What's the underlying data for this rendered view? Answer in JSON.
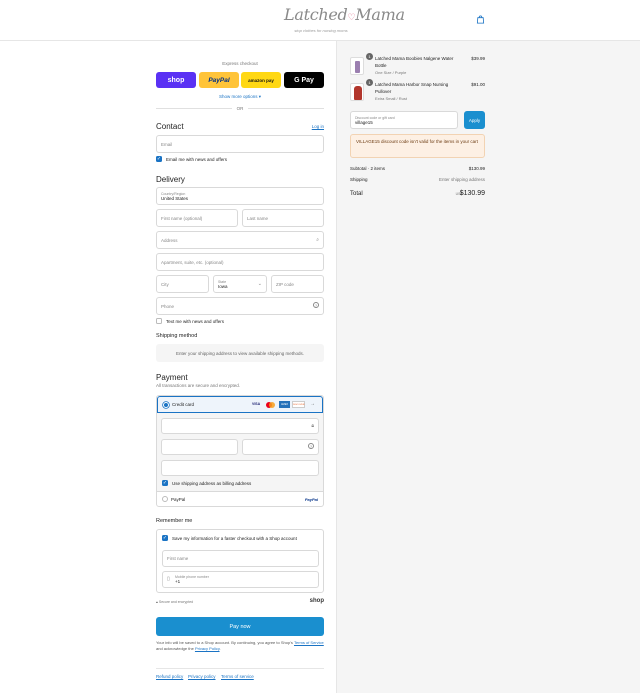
{
  "header": {
    "logo_text_1": "Latched",
    "logo_text_2": "Mama",
    "logo_tagline": "stop clothes for nursing moms",
    "cart_icon": "shopping-bag-icon"
  },
  "express": {
    "title": "Express checkout",
    "shop_label": "shop",
    "paypal_label": "PayPal",
    "amazon_label": "amazon pay",
    "gpay_label": "G Pay",
    "more_options": "Show more options ▾",
    "or_label": "OR"
  },
  "contact": {
    "heading": "Contact",
    "login_link": "Log in",
    "email_placeholder": "Email",
    "news_label": "Email me with news and offers"
  },
  "delivery": {
    "heading": "Delivery",
    "country_label": "Country/Region",
    "country_value": "United States",
    "first_name": "First name (optional)",
    "last_name": "Last name",
    "address": "Address",
    "apartment": "Apartment, suite, etc. (optional)",
    "city": "City",
    "state_label": "State",
    "state_value": "Iowa",
    "zip": "ZIP code",
    "phone": "Phone",
    "text_label": "Text me with news and offers"
  },
  "shipping": {
    "heading": "Shipping method",
    "message": "Enter your shipping address to view available shipping methods."
  },
  "payment": {
    "heading": "Payment",
    "subtitle": "All transactions are secure and encrypted.",
    "credit_card_label": "Credit card",
    "card_brands": [
      "VISA",
      "MC",
      "AMEX",
      "DISCOVER"
    ],
    "more_brands": "→",
    "billing_label": "Use shipping address as billing address",
    "paypal_label": "PayPal",
    "paypal_logo": "PayPal"
  },
  "remember": {
    "heading": "Remember me",
    "save_label": "Save my information for a faster checkout with a Shop account",
    "first_name": "First name",
    "mobile_label": "Mobile phone number",
    "mobile_value": "+1",
    "secure_label": "Secure and encrypted",
    "shop_logo": "shop"
  },
  "pay_button": "Pay now",
  "legal": {
    "line1": "Your info will be saved to a Shop account. By continuing, you agree to Shop's",
    "terms": "Terms of Service",
    "and": "and acknowledge the",
    "privacy": "Privacy Policy",
    "period": "."
  },
  "footer_links": [
    "Refund policy",
    "Privacy policy",
    "Terms of service"
  ],
  "summary": {
    "items": [
      {
        "qty": "1",
        "name": "Latched Mama Boobies Nalgene Water Bottle",
        "variant": "One Size / Purple",
        "price": "$39.99",
        "color": "#9b7fb0"
      },
      {
        "qty": "1",
        "name": "Latched Mama Harbor Snap Nursing Pullover",
        "variant": "Extra Small / Rust",
        "price": "$91.00",
        "color": "#b2362c"
      }
    ],
    "discount_label": "Discount code or gift card",
    "discount_value": "village15",
    "apply": "Apply",
    "error": "VILLAGE15 discount code isn't valid for the items in your cart",
    "subtotal_label": "Subtotal · 2 items",
    "subtotal_value": "$130.99",
    "shipping_label": "Shipping",
    "shipping_value": "Enter shipping address",
    "total_label": "Total",
    "currency": "USD",
    "total_value": "$130.99"
  }
}
